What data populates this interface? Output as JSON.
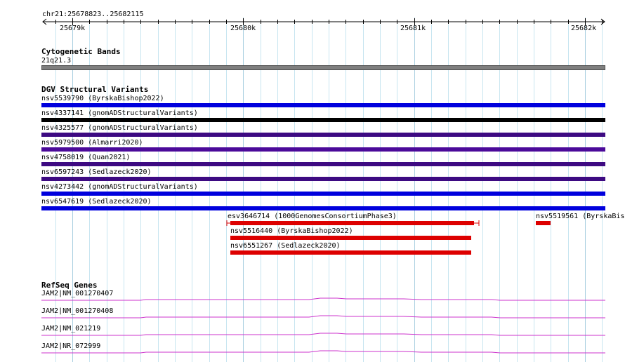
{
  "ruler": {
    "locus": "chr21:25678823..25682115",
    "ticks": [
      "25679k",
      "25680k",
      "25681k",
      "25682k"
    ]
  },
  "cyto_track": {
    "title": "Cytogenetic Bands",
    "band": "21q21.3"
  },
  "dgv_track": {
    "title": "DGV Structural Variants",
    "rows": [
      {
        "label": "nsv5539790 (ByrskaBishop2022)",
        "color": "#0000dd"
      },
      {
        "label": "nsv4337141 (gnomADStructuralVariants)",
        "color": "#000000"
      },
      {
        "label": "nsv4325577 (gnomADStructuralVariants)",
        "color": "#3d0a82"
      },
      {
        "label": "nsv5979500 (Almarri2020)",
        "color": "#4b0a9a"
      },
      {
        "label": "nsv4758019 (Quan2021)",
        "color": "#3d0a82"
      },
      {
        "label": "nsv6597243 (Sedlazeck2020)",
        "color": "#3d0a82"
      },
      {
        "label": "nsv4273442 (gnomADStructuralVariants)",
        "color": "#0000dd"
      },
      {
        "label": "nsv6547619 (Sedlazeck2020)",
        "color": "#0000dd"
      }
    ],
    "extra": [
      {
        "label": "esv3646714 (1000GenomesConsortiumPhase3)",
        "color": "#dd0000"
      },
      {
        "label": "nsv5516440 (ByrskaBishop2022)",
        "color": "#dd0000"
      },
      {
        "label": "nsv6551267 (Sedlazeck2020)",
        "color": "#dd0000"
      },
      {
        "label": "nsv5519561 (ByrskaBish",
        "color": "#dd0000"
      }
    ]
  },
  "refseq_track": {
    "title": "RefSeq Genes",
    "genes": [
      "JAM2|NM_001270407",
      "JAM2|NM_001270408",
      "JAM2|NM_021219",
      "JAM2|NR_072999"
    ],
    "color": "#cc33cc"
  },
  "colors": {
    "gridline": "#c7e5f0",
    "gridline_major": "#a9cfe0"
  }
}
